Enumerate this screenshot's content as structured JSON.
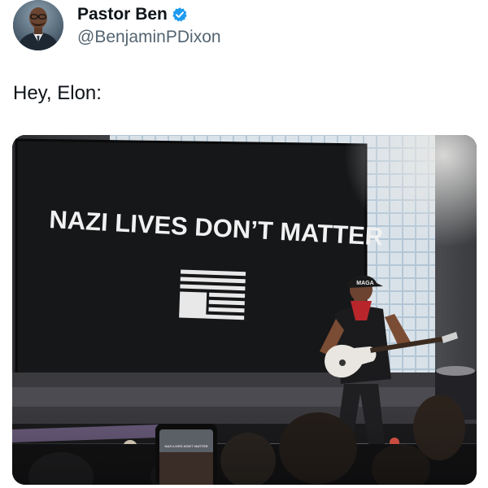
{
  "author": {
    "display_name": "Pastor Ben",
    "handle": "@BenjaminPDixon",
    "verified": true,
    "verified_icon": "verified-badge-icon",
    "verified_color": "#1d9bf0"
  },
  "tweet": {
    "text": "Hey, Elon:"
  },
  "media": {
    "screen_text": "NAZI LIVES DON’T MATTER",
    "guitarist_cap_text": "MAGA",
    "phone_screen_text": "NAZI LIVES DON’T MATTER"
  }
}
